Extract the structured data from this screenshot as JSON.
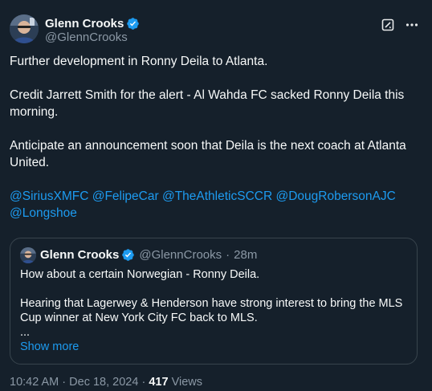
{
  "author": {
    "name": "Glenn Crooks",
    "handle": "@GlennCrooks",
    "verified": true
  },
  "tweet": {
    "paragraphs": [
      "Further development in Ronny Deila to Atlanta.",
      "Credit Jarrett Smith for the alert - Al Wahda FC sacked Ronny Deila this morning.",
      "Anticipate an announcement soon that Deila is the next coach at Atlanta United."
    ],
    "mentions": [
      "@SiriusXMFC",
      "@FelipeCar",
      "@TheAthleticSCCR",
      "@DougRobersonAJC",
      "@Longshoe"
    ]
  },
  "quote": {
    "name": "Glenn Crooks",
    "handle": "@GlennCrooks",
    "separator": "·",
    "time": "28m",
    "line1": "How about a certain Norwegian - Ronny Deila.",
    "line2": "Hearing that Lagerwey & Henderson have strong interest to bring the MLS Cup winner at New York City FC back to MLS.",
    "ellipsis": "...",
    "show_more": "Show more"
  },
  "meta": {
    "time": "10:42 AM",
    "dot": "·",
    "date": "Dec 18, 2024",
    "views_count": "417",
    "views_label": "Views"
  },
  "colors": {
    "background": "#15202b",
    "text": "#f7f9f9",
    "secondary": "#8b98a5",
    "link": "#1d9bf0",
    "border": "#38444d",
    "verified": "#1d9bf0"
  },
  "icons": {
    "verified": "verified-badge-icon",
    "grok": "grok-icon",
    "more": "more-options-icon"
  }
}
